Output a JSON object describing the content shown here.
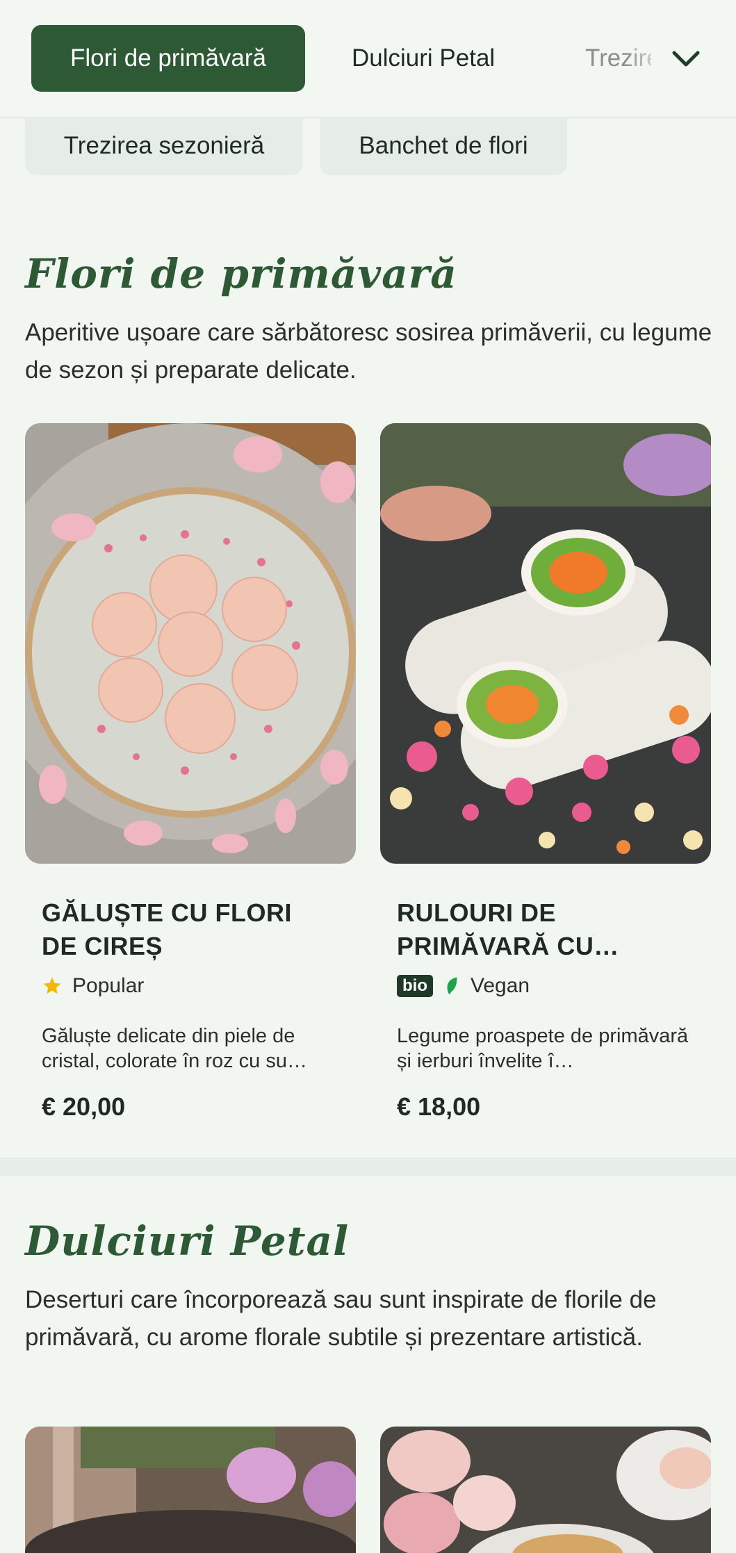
{
  "tabs": [
    {
      "label": "Flori de primăvară",
      "active": true
    },
    {
      "label": "Dulciuri Petal",
      "active": false
    },
    {
      "label": "Trezirea sezonieră",
      "active": false
    }
  ],
  "chips": [
    "Trezirea sezonieră",
    "Banchet de flori"
  ],
  "sections": [
    {
      "title": "Flori de primăvară",
      "description": "Aperitive ușoare care sărbătoresc sosirea primăverii, cu legume de sezon și preparate delicate.",
      "items": [
        {
          "title": "GĂLUȘTE CU FLORI DE CIREȘ",
          "tag": "Popular",
          "tag_icon": "star-icon",
          "description": "Găluște delicate din piele de cristal, colorate în roz cu su…",
          "price": "€ 20,00"
        },
        {
          "title": "RULOURI DE PRIMĂVARĂ CU…",
          "badge": "bio",
          "tag": "Vegan",
          "tag_icon": "leaf-icon",
          "description": "Legume proaspete de primăvară și ierburi învelite î…",
          "price": "€ 18,00"
        }
      ]
    },
    {
      "title": "Dulciuri Petal",
      "description": "Deserturi care încorporează sau sunt inspirate de florile de primăvară, cu arome florale subtile și prezentare artistică."
    }
  ],
  "colors": {
    "accent": "#2d5a35",
    "background": "#f2f6f1",
    "star": "#f5b800",
    "leaf": "#1fa24a"
  }
}
